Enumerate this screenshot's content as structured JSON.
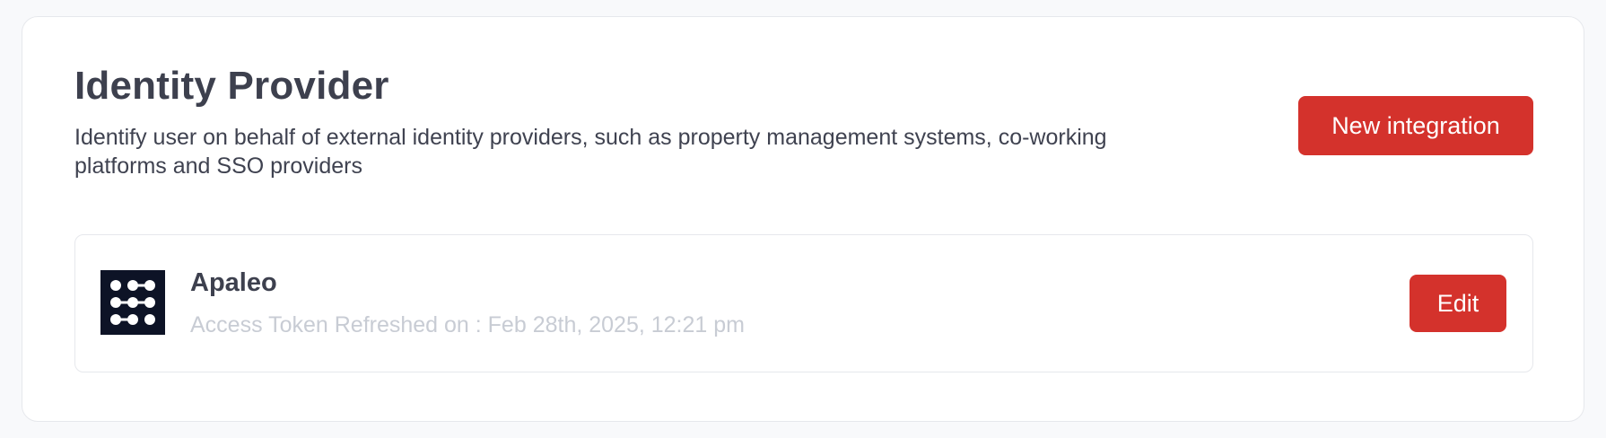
{
  "header": {
    "title": "Identity Provider",
    "description": "Identify user on behalf of external identity providers, such as property management systems, co-working platforms and SSO providers",
    "new_integration_label": "New integration"
  },
  "integrations": [
    {
      "name": "Apaleo",
      "logo_icon": "apaleo-logo-icon",
      "status_text": "Access Token Refreshed on : Feb 28th, 2025, 12:21 pm",
      "edit_label": "Edit"
    }
  ],
  "colors": {
    "accent": "#d4322c",
    "logo_background": "#0d1326",
    "muted_text": "#c8ccd4"
  }
}
